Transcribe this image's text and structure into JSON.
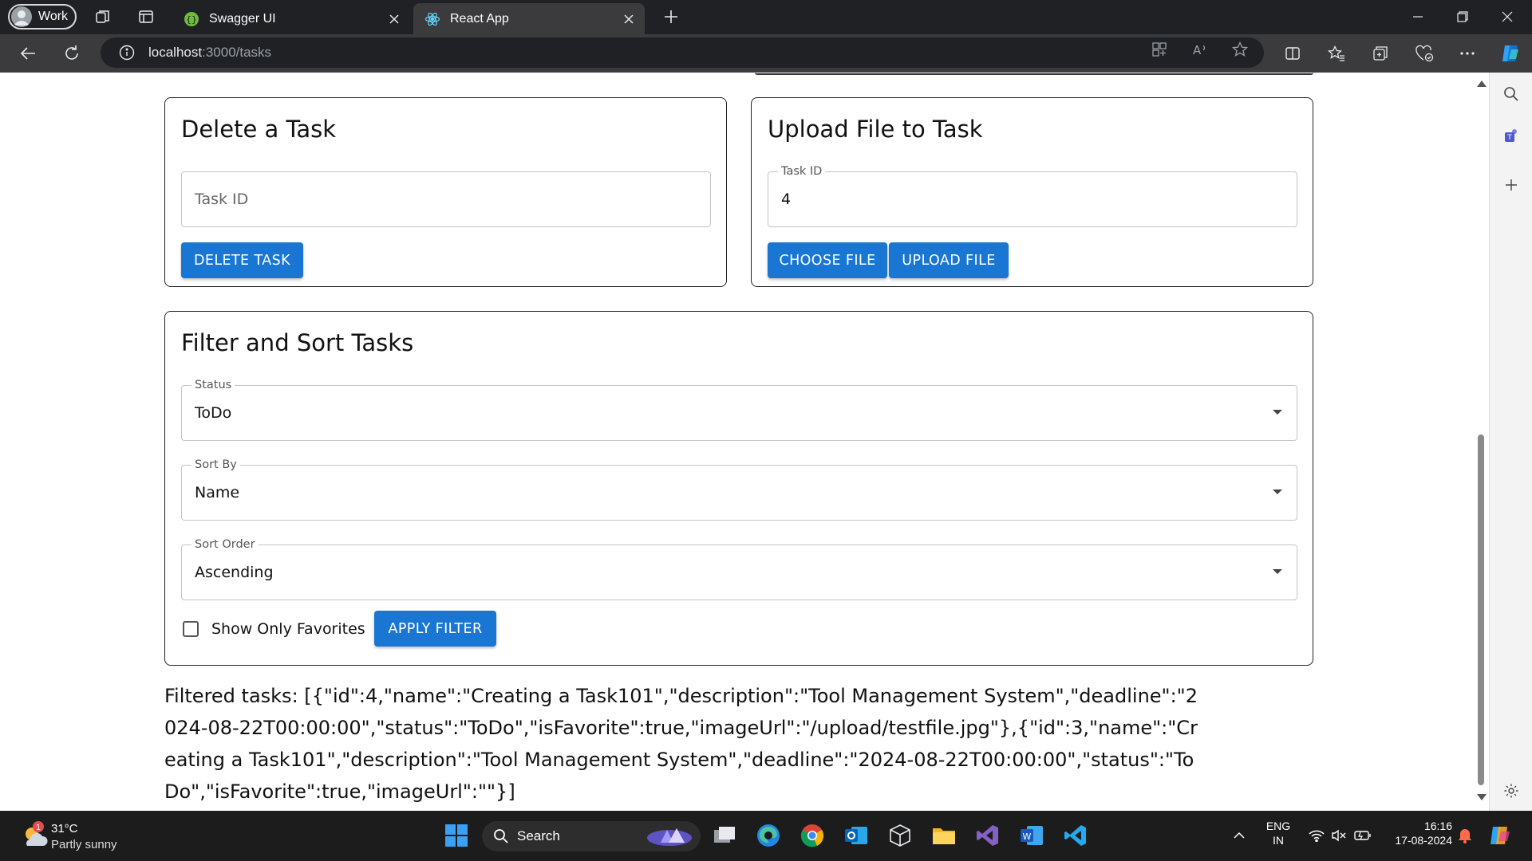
{
  "browser": {
    "profile_label": "Work",
    "tabs": [
      {
        "title": "Swagger UI"
      },
      {
        "title": "React App"
      }
    ],
    "url_host": "localhost",
    "url_path": ":3000/tasks"
  },
  "delete_card": {
    "title": "Delete a Task",
    "task_id_placeholder": "Task ID",
    "delete_button": "DELETE TASK"
  },
  "upload_card": {
    "title": "Upload File to Task",
    "task_id_label": "Task ID",
    "task_id_value": "4",
    "choose_button": "CHOOSE FILE",
    "upload_button": "UPLOAD FILE"
  },
  "filter_card": {
    "title": "Filter and Sort Tasks",
    "status_label": "Status",
    "status_value": "ToDo",
    "sort_by_label": "Sort By",
    "sort_by_value": "Name",
    "sort_order_label": "Sort Order",
    "sort_order_value": "Ascending",
    "favorites_label": "Show Only Favorites",
    "favorites_checked": false,
    "apply_button": "APPLY FILTER"
  },
  "result_text": "Filtered tasks: [{\"id\":4,\"name\":\"Creating a Task101\",\"description\":\"Tool Management System\",\"deadline\":\"2024-08-22T00:00:00\",\"status\":\"ToDo\",\"isFavorite\":true,\"imageUrl\":\"/upload/testfile.jpg\"},{\"id\":3,\"name\":\"Creating a Task101\",\"description\":\"Tool Management System\",\"deadline\":\"2024-08-22T00:00:00\",\"status\":\"ToDo\",\"isFavorite\":true,\"imageUrl\":\"\"}]",
  "taskbar": {
    "weather_temp": "31°C",
    "weather_desc": "Partly sunny",
    "weather_badge": "1",
    "search_label": "Search",
    "lang_line1": "ENG",
    "lang_line2": "IN",
    "time": "16:16",
    "date": "17-08-2024"
  },
  "colors": {
    "primary": "#1976d2",
    "tab_strip": "#202124",
    "toolbar": "#3b3b3d"
  }
}
